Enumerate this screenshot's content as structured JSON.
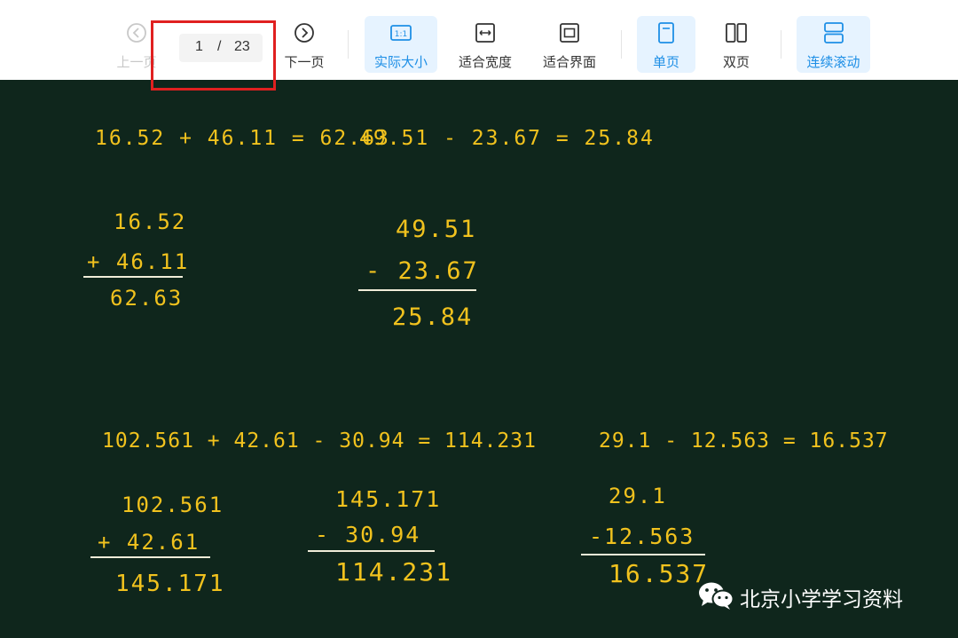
{
  "toolbar": {
    "prev": {
      "label": "上一页",
      "icon": "chevron-left-icon"
    },
    "page": {
      "current": "1",
      "separator": "/",
      "total": "23"
    },
    "next": {
      "label": "下一页",
      "icon": "chevron-right-icon"
    },
    "actual_size": {
      "label": "实际大小",
      "icon_text": "1:1"
    },
    "fit_width": {
      "label": "适合宽度",
      "icon": "fit-width-icon"
    },
    "fit_page": {
      "label": "适合界面",
      "icon": "fit-page-icon"
    },
    "single_page": {
      "label": "单页",
      "icon": "single-page-icon"
    },
    "double_page": {
      "label": "双页",
      "icon": "double-page-icon"
    },
    "continuous": {
      "label": "连续滚动",
      "icon": "continuous-scroll-icon"
    }
  },
  "colors": {
    "accent": "#1e8fe6",
    "active_bg": "#e6f3ff",
    "board": "#0f261c",
    "chalk_yellow": "#f1c21e",
    "highlight": "#e02020"
  },
  "board": {
    "eq1": "16.52 + 46.11 = 62.63",
    "eq2": "49.51 - 23.67 = 25.84",
    "v1": {
      "a": "16.52",
      "b": "+ 46.11",
      "r": "62.63"
    },
    "v2": {
      "a": "49.51",
      "b": "- 23.67",
      "r": "25.84"
    },
    "eq3": "102.561 + 42.61 - 30.94 = 114.231",
    "eq4": "29.1 - 12.563 = 16.537",
    "v3": {
      "a": "102.561",
      "b": "+ 42.61",
      "r": "145.171"
    },
    "v4": {
      "a": "145.171",
      "b": "- 30.94",
      "r": "114.231"
    },
    "v5": {
      "a": "29.1",
      "b": "-12.563",
      "r": "16.537"
    }
  },
  "watermark": {
    "text": "北京小学学习资料",
    "icon": "wechat-icon"
  }
}
